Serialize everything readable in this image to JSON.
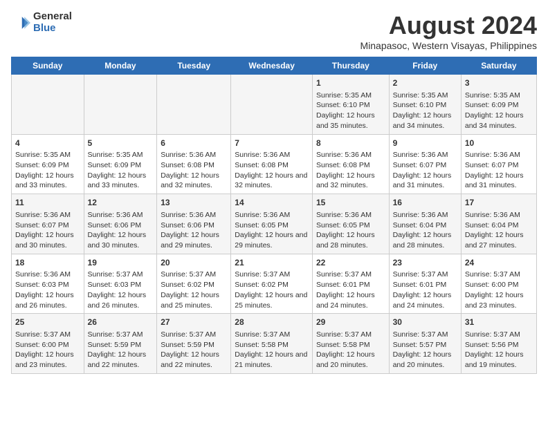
{
  "logo": {
    "general": "General",
    "blue": "Blue"
  },
  "title": "August 2024",
  "subtitle": "Minapasoc, Western Visayas, Philippines",
  "days_of_week": [
    "Sunday",
    "Monday",
    "Tuesday",
    "Wednesday",
    "Thursday",
    "Friday",
    "Saturday"
  ],
  "weeks": [
    [
      {
        "day": "",
        "sunrise": "",
        "sunset": "",
        "daylight": ""
      },
      {
        "day": "",
        "sunrise": "",
        "sunset": "",
        "daylight": ""
      },
      {
        "day": "",
        "sunrise": "",
        "sunset": "",
        "daylight": ""
      },
      {
        "day": "",
        "sunrise": "",
        "sunset": "",
        "daylight": ""
      },
      {
        "day": "1",
        "sunrise": "5:35 AM",
        "sunset": "6:10 PM",
        "daylight": "12 hours and 35 minutes."
      },
      {
        "day": "2",
        "sunrise": "5:35 AM",
        "sunset": "6:10 PM",
        "daylight": "12 hours and 34 minutes."
      },
      {
        "day": "3",
        "sunrise": "5:35 AM",
        "sunset": "6:09 PM",
        "daylight": "12 hours and 34 minutes."
      }
    ],
    [
      {
        "day": "4",
        "sunrise": "5:35 AM",
        "sunset": "6:09 PM",
        "daylight": "12 hours and 33 minutes."
      },
      {
        "day": "5",
        "sunrise": "5:35 AM",
        "sunset": "6:09 PM",
        "daylight": "12 hours and 33 minutes."
      },
      {
        "day": "6",
        "sunrise": "5:36 AM",
        "sunset": "6:08 PM",
        "daylight": "12 hours and 32 minutes."
      },
      {
        "day": "7",
        "sunrise": "5:36 AM",
        "sunset": "6:08 PM",
        "daylight": "12 hours and 32 minutes."
      },
      {
        "day": "8",
        "sunrise": "5:36 AM",
        "sunset": "6:08 PM",
        "daylight": "12 hours and 32 minutes."
      },
      {
        "day": "9",
        "sunrise": "5:36 AM",
        "sunset": "6:07 PM",
        "daylight": "12 hours and 31 minutes."
      },
      {
        "day": "10",
        "sunrise": "5:36 AM",
        "sunset": "6:07 PM",
        "daylight": "12 hours and 31 minutes."
      }
    ],
    [
      {
        "day": "11",
        "sunrise": "5:36 AM",
        "sunset": "6:07 PM",
        "daylight": "12 hours and 30 minutes."
      },
      {
        "day": "12",
        "sunrise": "5:36 AM",
        "sunset": "6:06 PM",
        "daylight": "12 hours and 30 minutes."
      },
      {
        "day": "13",
        "sunrise": "5:36 AM",
        "sunset": "6:06 PM",
        "daylight": "12 hours and 29 minutes."
      },
      {
        "day": "14",
        "sunrise": "5:36 AM",
        "sunset": "6:05 PM",
        "daylight": "12 hours and 29 minutes."
      },
      {
        "day": "15",
        "sunrise": "5:36 AM",
        "sunset": "6:05 PM",
        "daylight": "12 hours and 28 minutes."
      },
      {
        "day": "16",
        "sunrise": "5:36 AM",
        "sunset": "6:04 PM",
        "daylight": "12 hours and 28 minutes."
      },
      {
        "day": "17",
        "sunrise": "5:36 AM",
        "sunset": "6:04 PM",
        "daylight": "12 hours and 27 minutes."
      }
    ],
    [
      {
        "day": "18",
        "sunrise": "5:36 AM",
        "sunset": "6:03 PM",
        "daylight": "12 hours and 26 minutes."
      },
      {
        "day": "19",
        "sunrise": "5:37 AM",
        "sunset": "6:03 PM",
        "daylight": "12 hours and 26 minutes."
      },
      {
        "day": "20",
        "sunrise": "5:37 AM",
        "sunset": "6:02 PM",
        "daylight": "12 hours and 25 minutes."
      },
      {
        "day": "21",
        "sunrise": "5:37 AM",
        "sunset": "6:02 PM",
        "daylight": "12 hours and 25 minutes."
      },
      {
        "day": "22",
        "sunrise": "5:37 AM",
        "sunset": "6:01 PM",
        "daylight": "12 hours and 24 minutes."
      },
      {
        "day": "23",
        "sunrise": "5:37 AM",
        "sunset": "6:01 PM",
        "daylight": "12 hours and 24 minutes."
      },
      {
        "day": "24",
        "sunrise": "5:37 AM",
        "sunset": "6:00 PM",
        "daylight": "12 hours and 23 minutes."
      }
    ],
    [
      {
        "day": "25",
        "sunrise": "5:37 AM",
        "sunset": "6:00 PM",
        "daylight": "12 hours and 23 minutes."
      },
      {
        "day": "26",
        "sunrise": "5:37 AM",
        "sunset": "5:59 PM",
        "daylight": "12 hours and 22 minutes."
      },
      {
        "day": "27",
        "sunrise": "5:37 AM",
        "sunset": "5:59 PM",
        "daylight": "12 hours and 22 minutes."
      },
      {
        "day": "28",
        "sunrise": "5:37 AM",
        "sunset": "5:58 PM",
        "daylight": "12 hours and 21 minutes."
      },
      {
        "day": "29",
        "sunrise": "5:37 AM",
        "sunset": "5:58 PM",
        "daylight": "12 hours and 20 minutes."
      },
      {
        "day": "30",
        "sunrise": "5:37 AM",
        "sunset": "5:57 PM",
        "daylight": "12 hours and 20 minutes."
      },
      {
        "day": "31",
        "sunrise": "5:37 AM",
        "sunset": "5:56 PM",
        "daylight": "12 hours and 19 minutes."
      }
    ]
  ]
}
